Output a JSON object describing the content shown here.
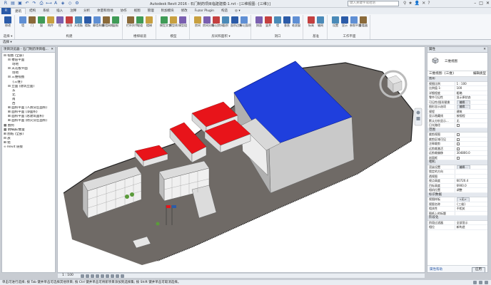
{
  "title": "Autodesk Revit 2016 -   石门制药项目临建建模-1.rvt - [三维视图: {三维}]",
  "search_placeholder": "键入关键字或短语",
  "menu_tabs": [
    "R",
    "建筑",
    "结构",
    "系统",
    "插入",
    "注释",
    "分析",
    "体量和场地",
    "协作",
    "视图",
    "管理",
    "附加模块",
    "修改",
    "Fuzor Plugin",
    "构造",
    "◎ ▾"
  ],
  "ribbon_groups": [
    {
      "label": "选择 ▾",
      "buttons": [
        "修改"
      ]
    },
    {
      "label": "构建",
      "buttons": [
        "墙",
        "门",
        "窗",
        "构件",
        "柱",
        "屋顶",
        "天花板",
        "楼板",
        "幕墙系统",
        "幕墙网格",
        "竖梃"
      ]
    },
    {
      "label": "楼梯坡道",
      "buttons": [
        "栏杆扶手",
        "坡道",
        "楼梯"
      ]
    },
    {
      "label": "模型",
      "buttons": [
        "模型文字",
        "模型线",
        "模型组"
      ]
    },
    {
      "label": "房间和面积 ▾",
      "buttons": [
        "房间",
        "房间分隔",
        "标记房间",
        "面积",
        "面积边界",
        "标记面积"
      ]
    },
    {
      "label": "洞口",
      "buttons": [
        "按面",
        "竖井",
        "墙",
        "垂直",
        "老虎窗"
      ]
    },
    {
      "label": "基准",
      "buttons": [
        "标高",
        "轴网"
      ]
    },
    {
      "label": "工作平面",
      "buttons": [
        "设置",
        "显示",
        "参照平面",
        "查看器"
      ]
    }
  ],
  "project_browser": {
    "title": "项目浏览器 - 石门制药项目临...",
    "nodes": [
      {
        "text": "⊟ 视图 (全部)",
        "depth": 0
      },
      {
        "text": "⊟ 楼层平面",
        "depth": 1
      },
      {
        "text": "场地",
        "depth": 2
      },
      {
        "text": "⊟ 天花板平面",
        "depth": 1
      },
      {
        "text": "场地",
        "depth": 2
      },
      {
        "text": "⊟ 三维视图",
        "depth": 1
      },
      {
        "text": "{三维}",
        "depth": 2
      },
      {
        "text": "⊟ 立面 (建筑立面)",
        "depth": 1
      },
      {
        "text": "东",
        "depth": 2
      },
      {
        "text": "北",
        "depth": 2
      },
      {
        "text": "南",
        "depth": 2
      },
      {
        "text": "西",
        "depth": 2
      },
      {
        "text": "⊞ 面积平面 (人防分区面积)",
        "depth": 1
      },
      {
        "text": "⊞ 面积平面 (净面积)",
        "depth": 1
      },
      {
        "text": "⊞ 面积平面 (总建筑面积)",
        "depth": 1
      },
      {
        "text": "⊞ 面积平面 (防火分区面积)",
        "depth": 1
      },
      {
        "text": "▦ 图例",
        "depth": 0
      },
      {
        "text": "▦ 明细表/数量",
        "depth": 0
      },
      {
        "text": "⊞ 图纸 (全部)",
        "depth": 0
      },
      {
        "text": "⊟ 族",
        "depth": 0
      },
      {
        "text": "⊞ 组",
        "depth": 0
      },
      {
        "text": "∞ Revit 链接",
        "depth": 0
      }
    ]
  },
  "properties": {
    "title": "属性",
    "type_name": "三维视图",
    "type_selector": "三维视图: {三维}",
    "edit_type": "编辑类型",
    "sections": [
      {
        "name": "图形",
        "rows": [
          {
            "name": "视图比例",
            "value": "1 : 100",
            "kind": "text"
          },
          {
            "name": "比例值 1:",
            "value": "100",
            "kind": "text"
          },
          {
            "name": "详细程度",
            "value": "粗略",
            "kind": "text"
          },
          {
            "name": "零件可见性",
            "value": "显示原状态",
            "kind": "text"
          },
          {
            "name": "可见性/图形替换",
            "value": "编辑...",
            "kind": "button"
          },
          {
            "name": "图形显示选项",
            "value": "编辑...",
            "kind": "button"
          },
          {
            "name": "规程",
            "value": "建筑",
            "kind": "text"
          },
          {
            "name": "显示隐藏线",
            "value": "按规程",
            "kind": "text"
          },
          {
            "name": "默认分析显示...",
            "value": "无",
            "kind": "text"
          },
          {
            "name": "日光路径",
            "value": "",
            "kind": "check"
          }
        ]
      },
      {
        "name": "范围",
        "rows": [
          {
            "name": "裁剪视图",
            "value": "",
            "kind": "check"
          },
          {
            "name": "裁剪区域可见",
            "value": "",
            "kind": "check"
          },
          {
            "name": "注释裁剪",
            "value": "",
            "kind": "check"
          },
          {
            "name": "远剪裁激活",
            "value": "",
            "kind": "check"
          },
          {
            "name": "远剪裁偏移",
            "value": "304800.0",
            "kind": "text"
          },
          {
            "name": "剖面框",
            "value": "",
            "kind": "check"
          }
        ]
      },
      {
        "name": "相机",
        "rows": [
          {
            "name": "渲染设置",
            "value": "编辑...",
            "kind": "button"
          },
          {
            "name": "锁定的方向",
            "value": "",
            "kind": "text"
          },
          {
            "name": "透视图",
            "value": "",
            "kind": "text"
          },
          {
            "name": "视点高度",
            "value": "60720.4",
            "kind": "text"
          },
          {
            "name": "目标高度",
            "value": "6900.0",
            "kind": "text"
          },
          {
            "name": "相机位置",
            "value": "调整",
            "kind": "text"
          }
        ]
      },
      {
        "name": "标识数据",
        "rows": [
          {
            "name": "视图样板",
            "value": "<无>",
            "kind": "button"
          },
          {
            "name": "视图名称",
            "value": "{三维}",
            "kind": "text"
          },
          {
            "name": "相关性",
            "value": "不相关",
            "kind": "text"
          },
          {
            "name": "图纸上的标题",
            "value": "",
            "kind": "text"
          }
        ]
      },
      {
        "name": "阶段化",
        "rows": [
          {
            "name": "阶段过滤器",
            "value": "全部显示",
            "kind": "text"
          },
          {
            "name": "相位",
            "value": "新构造",
            "kind": "text"
          }
        ]
      }
    ],
    "help_link": "属性帮助",
    "apply": "应用"
  },
  "view_scale": "1 : 100",
  "status_text": "单击可进行选择; 按 Tab 键并单击可选择其他项目; 按 Ctrl 键并单击可将新项目添加到选择集; 按 Shift 键并单击可取消选择。",
  "status_right": ":0",
  "colors": {
    "accent": "#2b5ba8",
    "roof_blue": "#1f3fdd",
    "roof_red": "#e8141a",
    "ground": "#6f6a66"
  }
}
